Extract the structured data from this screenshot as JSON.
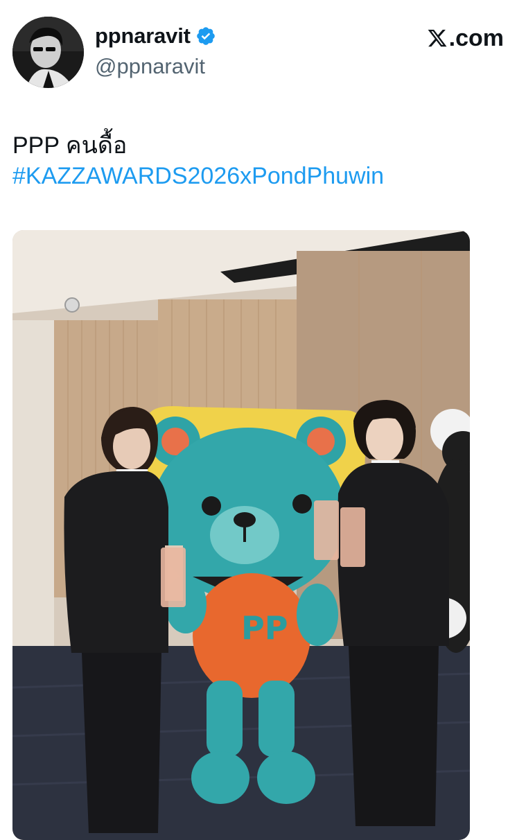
{
  "author": {
    "display_name": "ppnaravit",
    "handle": "@ppnaravit",
    "verified": true,
    "avatar_icon": "profile-avatar"
  },
  "brand": {
    "site": ".com",
    "logo_icon": "x-logo-icon"
  },
  "tweet": {
    "text_line": "PPP คนดื้อ",
    "hashtag": "#KAZZAWARDS2026xPondPhuwin",
    "hashtag_color": "#1d9bf0"
  },
  "media": {
    "mascot_chest_logo": "PP"
  },
  "colors": {
    "verified_badge": "#1d9bf0",
    "text_primary": "#0f1419",
    "text_secondary": "#536471"
  }
}
